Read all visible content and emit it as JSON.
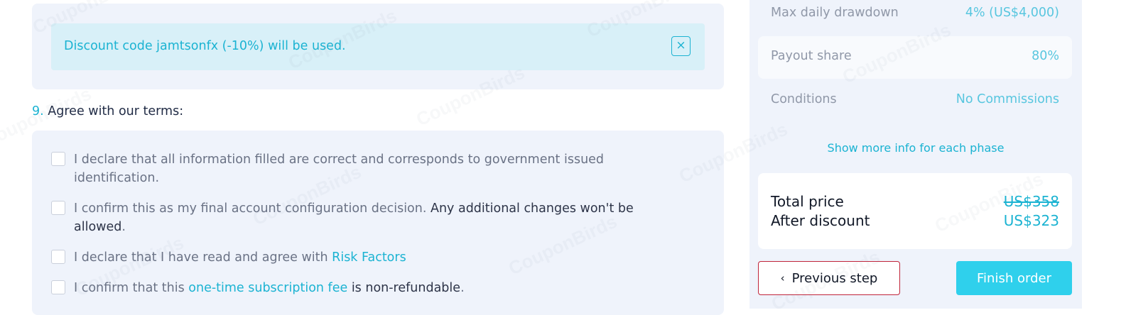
{
  "discount_alert": {
    "text": "Discount code jamtsonfx (-10%) will be used.",
    "close_icon": "×"
  },
  "terms_section": {
    "number": "9.",
    "title": "Agree with our terms:",
    "items": [
      {
        "text": "I declare that all information filled are correct and corresponds to government issued identification."
      },
      {
        "text": "I confirm this as my final account configuration decision. ",
        "strong": "Any additional changes won't be allowed",
        "suffix": "."
      },
      {
        "text": "I declare that I have read and agree with ",
        "link": "Risk Factors"
      },
      {
        "prefix": "I confirm that this ",
        "link": "one-time subscription fee",
        "mid": " is non-refundable",
        "suffix": "."
      }
    ]
  },
  "summary": {
    "rows": [
      {
        "label": "Max daily drawdown",
        "value": "4% (US$4,000)"
      },
      {
        "label": "Payout share",
        "value": "80%"
      },
      {
        "label": "Conditions",
        "value": "No Commissions"
      }
    ],
    "more_info_link": "Show more info for each phase",
    "total_label": "Total price",
    "total_value": "US$358",
    "discount_label": "After discount",
    "discount_value": "US$323"
  },
  "buttons": {
    "prev_icon": "‹",
    "prev_label": "Previous step",
    "finish_label": "Finish order"
  },
  "watermark_text": "CouponBirds",
  "colors": {
    "accent": "#1bb3d2",
    "panel_bg": "#eff3fb",
    "alert_bg": "#d8f0f8",
    "finish_button": "#2fd0ec",
    "prev_border": "#c0243a"
  }
}
